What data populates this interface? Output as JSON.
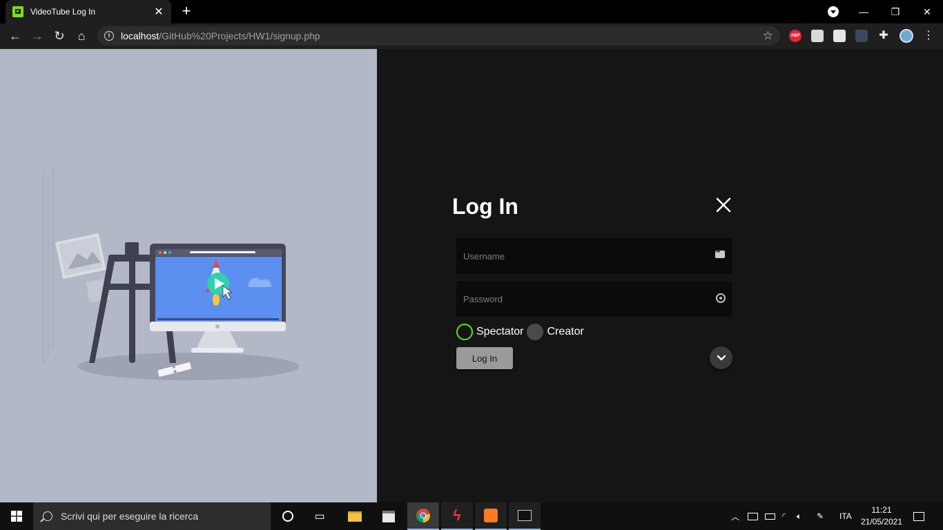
{
  "browser": {
    "tab": {
      "title": "VideoTube Log In"
    },
    "address_bar": {
      "host": "localhost",
      "path": "/GitHub%20Projects/HW1/signup.php"
    },
    "extensions": {
      "abp_label": "ABP"
    }
  },
  "login": {
    "title": "Log In",
    "username": {
      "placeholder": "Username",
      "value": ""
    },
    "password": {
      "placeholder": "Password",
      "value": ""
    },
    "roles": [
      {
        "label": "Spectator",
        "selected": true
      },
      {
        "label": "Creator",
        "selected": false
      }
    ],
    "submit_label": "Log In",
    "accent_color": "#5ce21e"
  },
  "taskbar": {
    "search_placeholder": "Scrivi qui per eseguire la ricerca",
    "language": "ITA",
    "time": "11:21",
    "date": "21/05/2021"
  }
}
